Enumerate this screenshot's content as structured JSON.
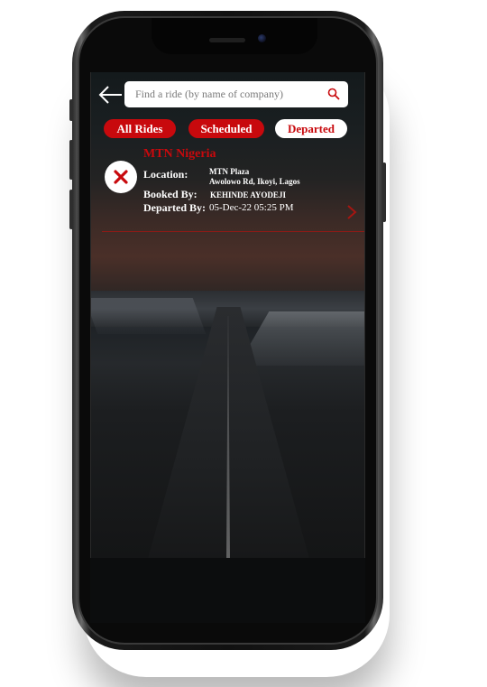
{
  "search": {
    "placeholder": "Find a ride (by name of company)"
  },
  "tabs": [
    {
      "label": "All Rides",
      "active": false
    },
    {
      "label": "Scheduled",
      "active": false
    },
    {
      "label": "Departed",
      "active": true
    }
  ],
  "ride": {
    "company": "MTN Nigeria",
    "location_label": "Location:",
    "location_line1": "MTN Plaza",
    "location_line2": "Awolowo Rd, Ikoyi, Lagos",
    "booked_by_label": "Booked By:",
    "booked_by_value": "KEHINDE AYODEJI",
    "departed_by_label": "Departed By:",
    "departed_by_value": "05-Dec-22  05:25 PM"
  },
  "icons": {
    "back": "arrow-left-icon",
    "search": "search-icon",
    "cancel": "close-icon",
    "next": "chevron-right-icon"
  },
  "colors": {
    "accent": "#c8090d",
    "tab_active_bg": "#ffffff",
    "text_on_dark": "#ffffff"
  }
}
